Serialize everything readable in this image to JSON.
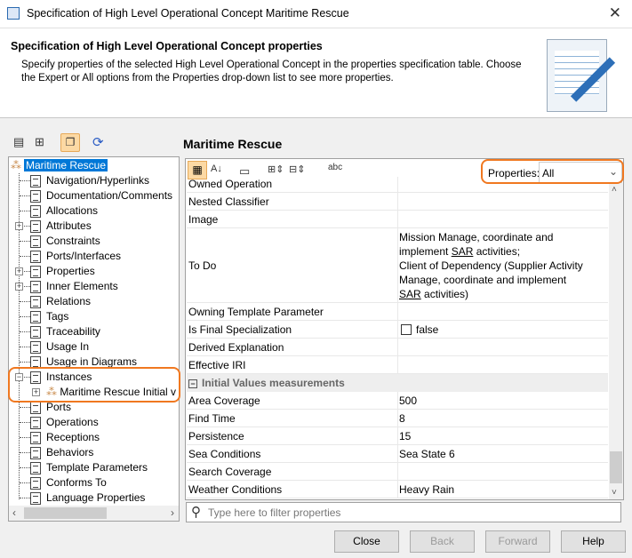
{
  "window": {
    "title": "Specification of High Level Operational Concept Maritime Rescue"
  },
  "header": {
    "title": "Specification of High Level Operational Concept properties",
    "description": "Specify properties of the selected High Level Operational Concept in the properties specification table. Choose the Expert or All options from the Properties drop-down list to see more properties."
  },
  "tree": {
    "root": "Maritime Rescue",
    "items": [
      {
        "label": "Navigation/Hyperlinks"
      },
      {
        "label": "Documentation/Comments"
      },
      {
        "label": "Allocations"
      },
      {
        "label": "Attributes",
        "expander": "+"
      },
      {
        "label": "Constraints"
      },
      {
        "label": "Ports/Interfaces"
      },
      {
        "label": "Properties",
        "expander": "+"
      },
      {
        "label": "Inner Elements",
        "expander": "+"
      },
      {
        "label": "Relations"
      },
      {
        "label": "Tags"
      },
      {
        "label": "Traceability"
      },
      {
        "label": "Usage In"
      },
      {
        "label": "Usage in Diagrams"
      },
      {
        "label": "Instances",
        "expander": "-"
      },
      {
        "label": "Maritime Rescue Initial v",
        "child": true
      },
      {
        "label": "Ports"
      },
      {
        "label": "Operations"
      },
      {
        "label": "Receptions"
      },
      {
        "label": "Behaviors"
      },
      {
        "label": "Template Parameters"
      },
      {
        "label": "Conforms To"
      },
      {
        "label": "Language Properties"
      }
    ]
  },
  "main": {
    "title": "Maritime Rescue",
    "properties_label": "Properties:",
    "properties_value": "All"
  },
  "table": {
    "rows": [
      {
        "name": "Owned Operation",
        "value": ""
      },
      {
        "name": "Nested Classifier",
        "value": ""
      },
      {
        "name": "Image",
        "value": ""
      },
      {
        "name": "To Do",
        "value_lines": [
          "Mission Manage, coordinate and",
          "implement SAR activities;",
          "Client of Dependency (Supplier Activity",
          "Manage, coordinate and implement",
          "SAR activities)"
        ]
      },
      {
        "name": "Owning Template Parameter",
        "value": ""
      },
      {
        "name": "Is Final Specialization",
        "value": "false"
      },
      {
        "name": "Derived Explanation",
        "value": ""
      },
      {
        "name": "Effective IRI",
        "value": ""
      }
    ],
    "group": "Initial Values measurements",
    "group_rows": [
      {
        "name": "Area Coverage",
        "value": "500"
      },
      {
        "name": "Find Time",
        "value": "8"
      },
      {
        "name": "Persistence",
        "value": "15"
      },
      {
        "name": "Sea Conditions",
        "value": "Sea State 6"
      },
      {
        "name": "Search Coverage",
        "value": ""
      },
      {
        "name": "Weather Conditions",
        "value": "Heavy Rain"
      }
    ]
  },
  "filter": {
    "placeholder": "Type here to filter properties"
  },
  "buttons": {
    "close": "Close",
    "back": "Back",
    "forward": "Forward",
    "help": "Help"
  },
  "colors": {
    "highlight": "#f07820",
    "selection": "#0078d7"
  }
}
